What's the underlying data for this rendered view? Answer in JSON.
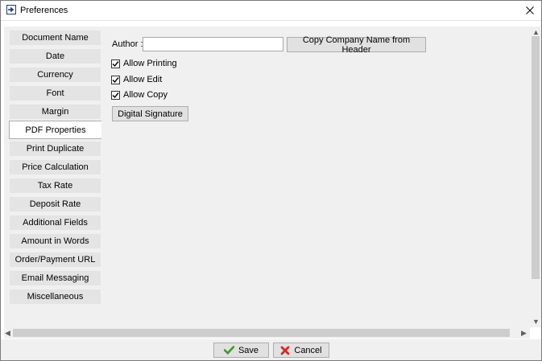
{
  "window": {
    "title": "Preferences",
    "icon": "export-icon"
  },
  "sidebar": {
    "items": [
      {
        "label": "Document Name"
      },
      {
        "label": "Date"
      },
      {
        "label": "Currency"
      },
      {
        "label": "Font"
      },
      {
        "label": "Margin"
      },
      {
        "label": "PDF Properties",
        "selected": true
      },
      {
        "label": "Print Duplicate"
      },
      {
        "label": "Price Calculation"
      },
      {
        "label": "Tax Rate"
      },
      {
        "label": "Deposit Rate"
      },
      {
        "label": "Additional Fields"
      },
      {
        "label": "Amount in Words"
      },
      {
        "label": "Order/Payment URL"
      },
      {
        "label": "Email Messaging"
      },
      {
        "label": "Miscellaneous"
      }
    ]
  },
  "pdf": {
    "author_label": "Author :",
    "author_value": "",
    "copy_button": "Copy Company Name from Header",
    "allow_printing": {
      "label": "Allow Printing",
      "checked": true
    },
    "allow_edit": {
      "label": "Allow Edit",
      "checked": true
    },
    "allow_copy": {
      "label": "Allow Copy",
      "checked": true
    },
    "signature_button": "Digital Signature"
  },
  "footer": {
    "save_label": "Save",
    "cancel_label": "Cancel",
    "save_color": "#3c9a2b",
    "cancel_color": "#d9262b"
  }
}
